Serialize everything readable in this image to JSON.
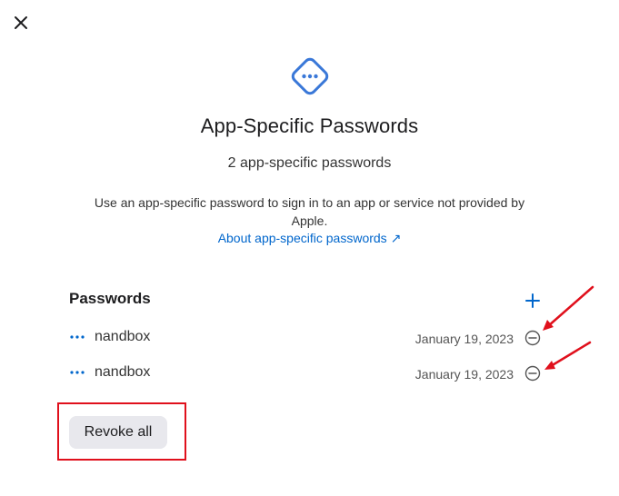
{
  "dialog": {
    "title": "App-Specific Passwords",
    "subtitle": "2 app-specific passwords",
    "description": "Use an app-specific password to sign in to an app or service not provided by Apple.",
    "about_link": "About app-specific passwords ↗",
    "close_icon": "close-icon",
    "hero_icon": "dots-diamond-icon"
  },
  "passwords_section": {
    "title": "Passwords",
    "add_icon": "plus-icon",
    "items": [
      {
        "name": "nandbox",
        "date": "January 19, 2023",
        "icon": "dots-icon",
        "remove_icon": "minus-circle-icon"
      },
      {
        "name": "nandbox",
        "date": "January 19, 2023",
        "icon": "dots-icon",
        "remove_icon": "minus-circle-icon"
      }
    ],
    "revoke_all_label": "Revoke all"
  },
  "annotations": {
    "color": "#e0101c",
    "accent": "#0066cc"
  }
}
